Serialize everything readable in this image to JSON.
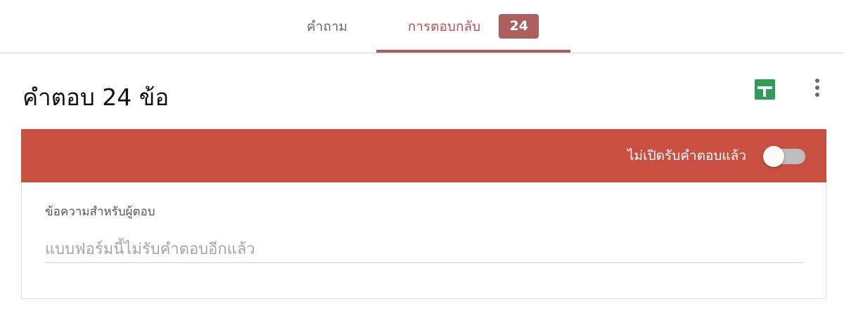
{
  "tabs": {
    "questions_label": "คำถาม",
    "responses_label": "การตอบกลับ",
    "responses_count": "24"
  },
  "header": {
    "title": "คำตอบ 24 ข้อ",
    "sheets_icon": "google-sheets-icon",
    "more_icon": "more-vert-icon"
  },
  "banner": {
    "status_text": "ไม่เปิดรับคำตอบแล้ว",
    "toggle_on": false,
    "background_color": "#c84f41"
  },
  "message": {
    "label": "ข้อความสำหรับผู้ตอบ",
    "placeholder": "แบบฟอร์มนี้ไม่รับคำตอบอีกแล้ว",
    "value": ""
  },
  "colors": {
    "accent": "#b6575b",
    "badge": "#ad5f60",
    "sheets_green": "#2e9d57"
  }
}
